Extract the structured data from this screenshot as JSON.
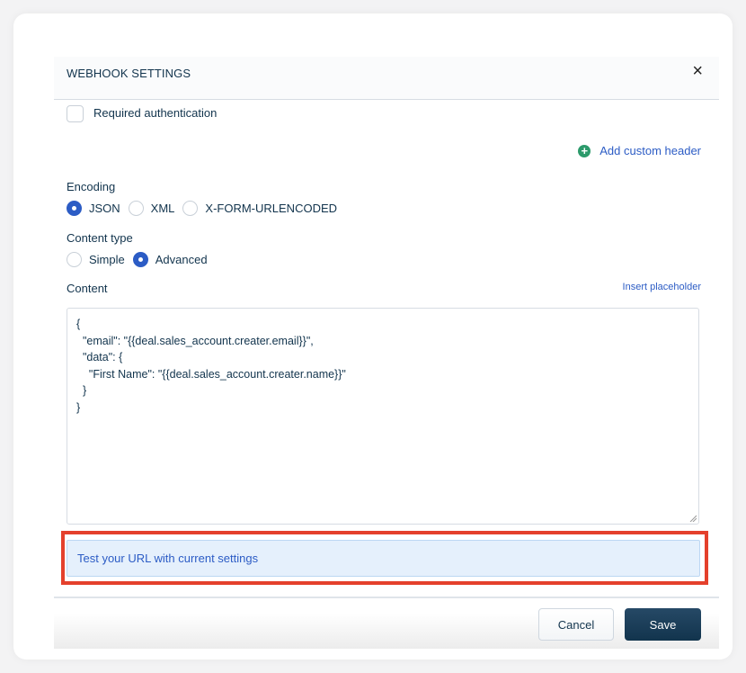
{
  "modal": {
    "title": "WEBHOOK SETTINGS",
    "close_icon": "×"
  },
  "auth": {
    "label": "Required authentication",
    "checked": false
  },
  "custom_header": {
    "icon": "+",
    "label": "Add custom header"
  },
  "encoding": {
    "label": "Encoding",
    "options": [
      {
        "label": "JSON",
        "selected": true
      },
      {
        "label": "XML",
        "selected": false
      },
      {
        "label": "X-FORM-URLENCODED",
        "selected": false
      }
    ]
  },
  "content_type": {
    "label": "Content type",
    "options": [
      {
        "label": "Simple",
        "selected": false
      },
      {
        "label": "Advanced",
        "selected": true
      }
    ]
  },
  "content": {
    "label": "Content",
    "insert_placeholder": "Insert placeholder",
    "value": "{\n  \"email\": \"{{deal.sales_account.creater.email}}\",\n  \"data\": {\n    \"First Name\": \"{{deal.sales_account.creater.name}}\"\n  }\n}"
  },
  "test": {
    "label": "Test your URL with current settings"
  },
  "footer": {
    "cancel_label": "Cancel",
    "save_label": "Save"
  },
  "colors": {
    "accent": "#2c5cc5",
    "primary_button": "#12344d",
    "highlight_border": "#e4402c",
    "add_icon": "#2c9a6b"
  }
}
